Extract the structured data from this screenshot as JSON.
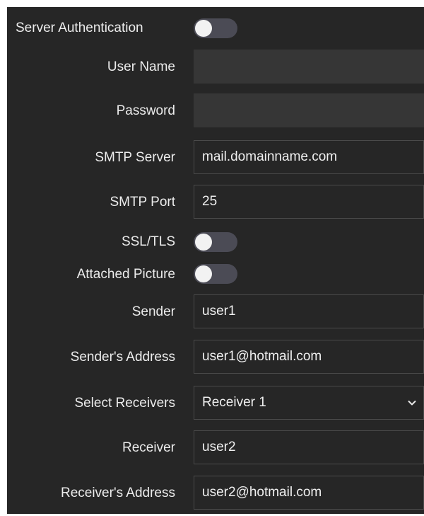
{
  "form": {
    "server_authentication": {
      "label": "Server Authentication",
      "enabled": false
    },
    "user_name": {
      "label": "User Name",
      "value": ""
    },
    "password": {
      "label": "Password",
      "value": ""
    },
    "smtp_server": {
      "label": "SMTP Server",
      "value": "mail.domainname.com"
    },
    "smtp_port": {
      "label": "SMTP Port",
      "value": "25"
    },
    "ssl_tls": {
      "label": "SSL/TLS",
      "enabled": false
    },
    "attached_picture": {
      "label": "Attached Picture",
      "enabled": false
    },
    "sender": {
      "label": "Sender",
      "value": "user1"
    },
    "sender_address": {
      "label": "Sender's Address",
      "value": "user1@hotmail.com"
    },
    "select_receivers": {
      "label": "Select Receivers",
      "value": "Receiver 1",
      "icon": "chevron-down-icon"
    },
    "receiver": {
      "label": "Receiver",
      "value": "user2"
    },
    "receiver_address": {
      "label": "Receiver's Address",
      "value": "user2@hotmail.com"
    }
  },
  "colors": {
    "panel_background": "#262626",
    "field_border": "#4a4a4a",
    "disabled_field": "#363636",
    "toggle_track_off": "#4b4b55",
    "toggle_knob": "#f2f2f2",
    "text": "#ececec"
  }
}
